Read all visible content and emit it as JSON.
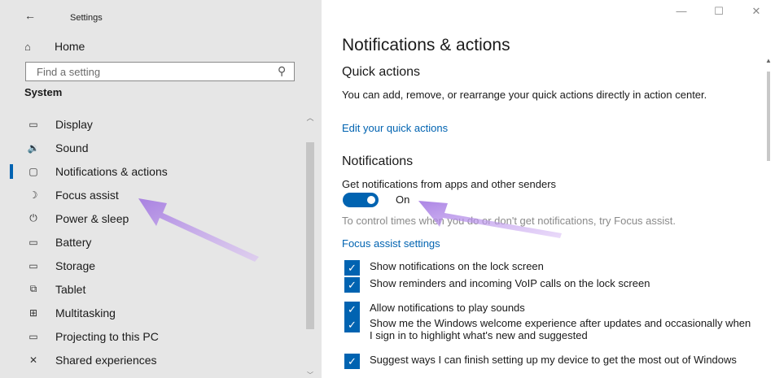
{
  "window": {
    "title": "Settings",
    "controls": {
      "minimize": "—",
      "maximize": "☐",
      "close": "✕"
    }
  },
  "sidebar": {
    "home_label": "Home",
    "search_placeholder": "Find a setting",
    "section_heading": "System",
    "items": [
      {
        "label": "Display",
        "icon": "display-icon",
        "glyph": "▭"
      },
      {
        "label": "Sound",
        "icon": "sound-icon",
        "glyph": "🔉"
      },
      {
        "label": "Notifications & actions",
        "icon": "notifications-icon",
        "glyph": "▢",
        "selected": true
      },
      {
        "label": "Focus assist",
        "icon": "focus-assist-icon",
        "glyph": "☽"
      },
      {
        "label": "Power & sleep",
        "icon": "power-icon",
        "glyph": "⏻"
      },
      {
        "label": "Battery",
        "icon": "battery-icon",
        "glyph": "▭"
      },
      {
        "label": "Storage",
        "icon": "storage-icon",
        "glyph": "▭"
      },
      {
        "label": "Tablet",
        "icon": "tablet-icon",
        "glyph": "⧉"
      },
      {
        "label": "Multitasking",
        "icon": "multitasking-icon",
        "glyph": "⊞"
      },
      {
        "label": "Projecting to this PC",
        "icon": "projecting-icon",
        "glyph": "▭"
      },
      {
        "label": "Shared experiences",
        "icon": "shared-experiences-icon",
        "glyph": "✕"
      }
    ]
  },
  "main": {
    "page_title": "Notifications & actions",
    "quick_actions": {
      "heading": "Quick actions",
      "description": "You can add, remove, or rearrange your quick actions directly in action center.",
      "link": "Edit your quick actions"
    },
    "notifications": {
      "heading": "Notifications",
      "toggle_caption": "Get notifications from apps and other senders",
      "toggle_state": "On",
      "toggle_on": true,
      "hint": "To control times when you do or don't get notifications, try Focus assist.",
      "hint_link": "Focus assist settings",
      "checkboxes": [
        {
          "label": "Show notifications on the lock screen",
          "checked": true
        },
        {
          "label": "Show reminders and incoming VoIP calls on the lock screen",
          "checked": true
        },
        {
          "label": "Allow notifications to play sounds",
          "checked": true
        },
        {
          "label": "Show me the Windows welcome experience after updates and occasionally when I sign in to highlight what's new and suggested",
          "checked": true
        },
        {
          "label": "Suggest ways I can finish setting up my device to get the most out of Windows",
          "checked": true
        }
      ]
    }
  },
  "colors": {
    "accent": "#0063b1",
    "sidebar_bg": "#e6e6e6",
    "annotation_arrow": "#b48be6"
  }
}
